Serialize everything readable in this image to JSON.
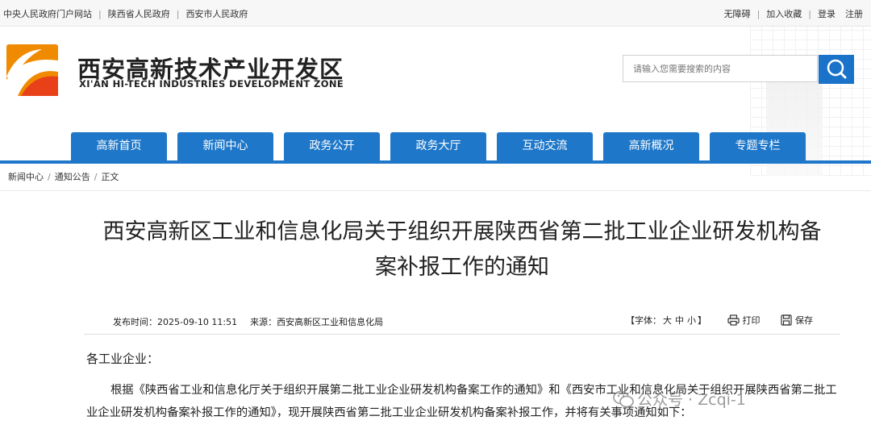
{
  "topbar": {
    "links": [
      "中央人民政府门户网站",
      "陕西省人民政府",
      "西安市人民政府"
    ],
    "right": [
      "无障碍",
      "加入收藏",
      "登录",
      "注册"
    ]
  },
  "header": {
    "site_name": "西安高新技术产业开发区",
    "site_name_en": "XI'AN HI-TECH INDUSTRIES DEVELOPMENT ZONE",
    "search_placeholder": "请输入您需要搜索的内容"
  },
  "nav": [
    "高新首页",
    "新闻中心",
    "政务公开",
    "政务大厅",
    "互动交流",
    "高新概况",
    "专题专栏"
  ],
  "breadcrumb": [
    "新闻中心",
    "通知公告",
    "正文"
  ],
  "article": {
    "title_line1": "西安高新区工业和信息化局关于组织开展陕西省第二批工业企业研发机构备",
    "title_line2": "案补报工作的通知",
    "publish_label": "发布时间：",
    "publish_time": "2025-09-10 11:51",
    "source_label": "来源：",
    "source": "西安高新区工业和信息化局",
    "font_label": "【字体：",
    "font_big": "大",
    "font_mid": "中",
    "font_small": "小",
    "font_end": "】",
    "print": "打印",
    "save": "保存",
    "greeting": "各工业企业：",
    "paragraph": "根据《陕西省工业和信息化厅关于组织开展第二批工业企业研发机构备案工作的通知》和《西安市工业和信息化局关于组织开展陕西省第二批工业企业研发机构备案补报工作的通知》，现开展陕西省第二批工业企业研发机构备案补报工作，并将有关事项通知如下："
  },
  "watermark": "公众号 · Zcqi-1",
  "colors": {
    "nav_blue": "#1e77c9",
    "logo_orange": "#f08a00",
    "logo_red": "#e8411a"
  }
}
